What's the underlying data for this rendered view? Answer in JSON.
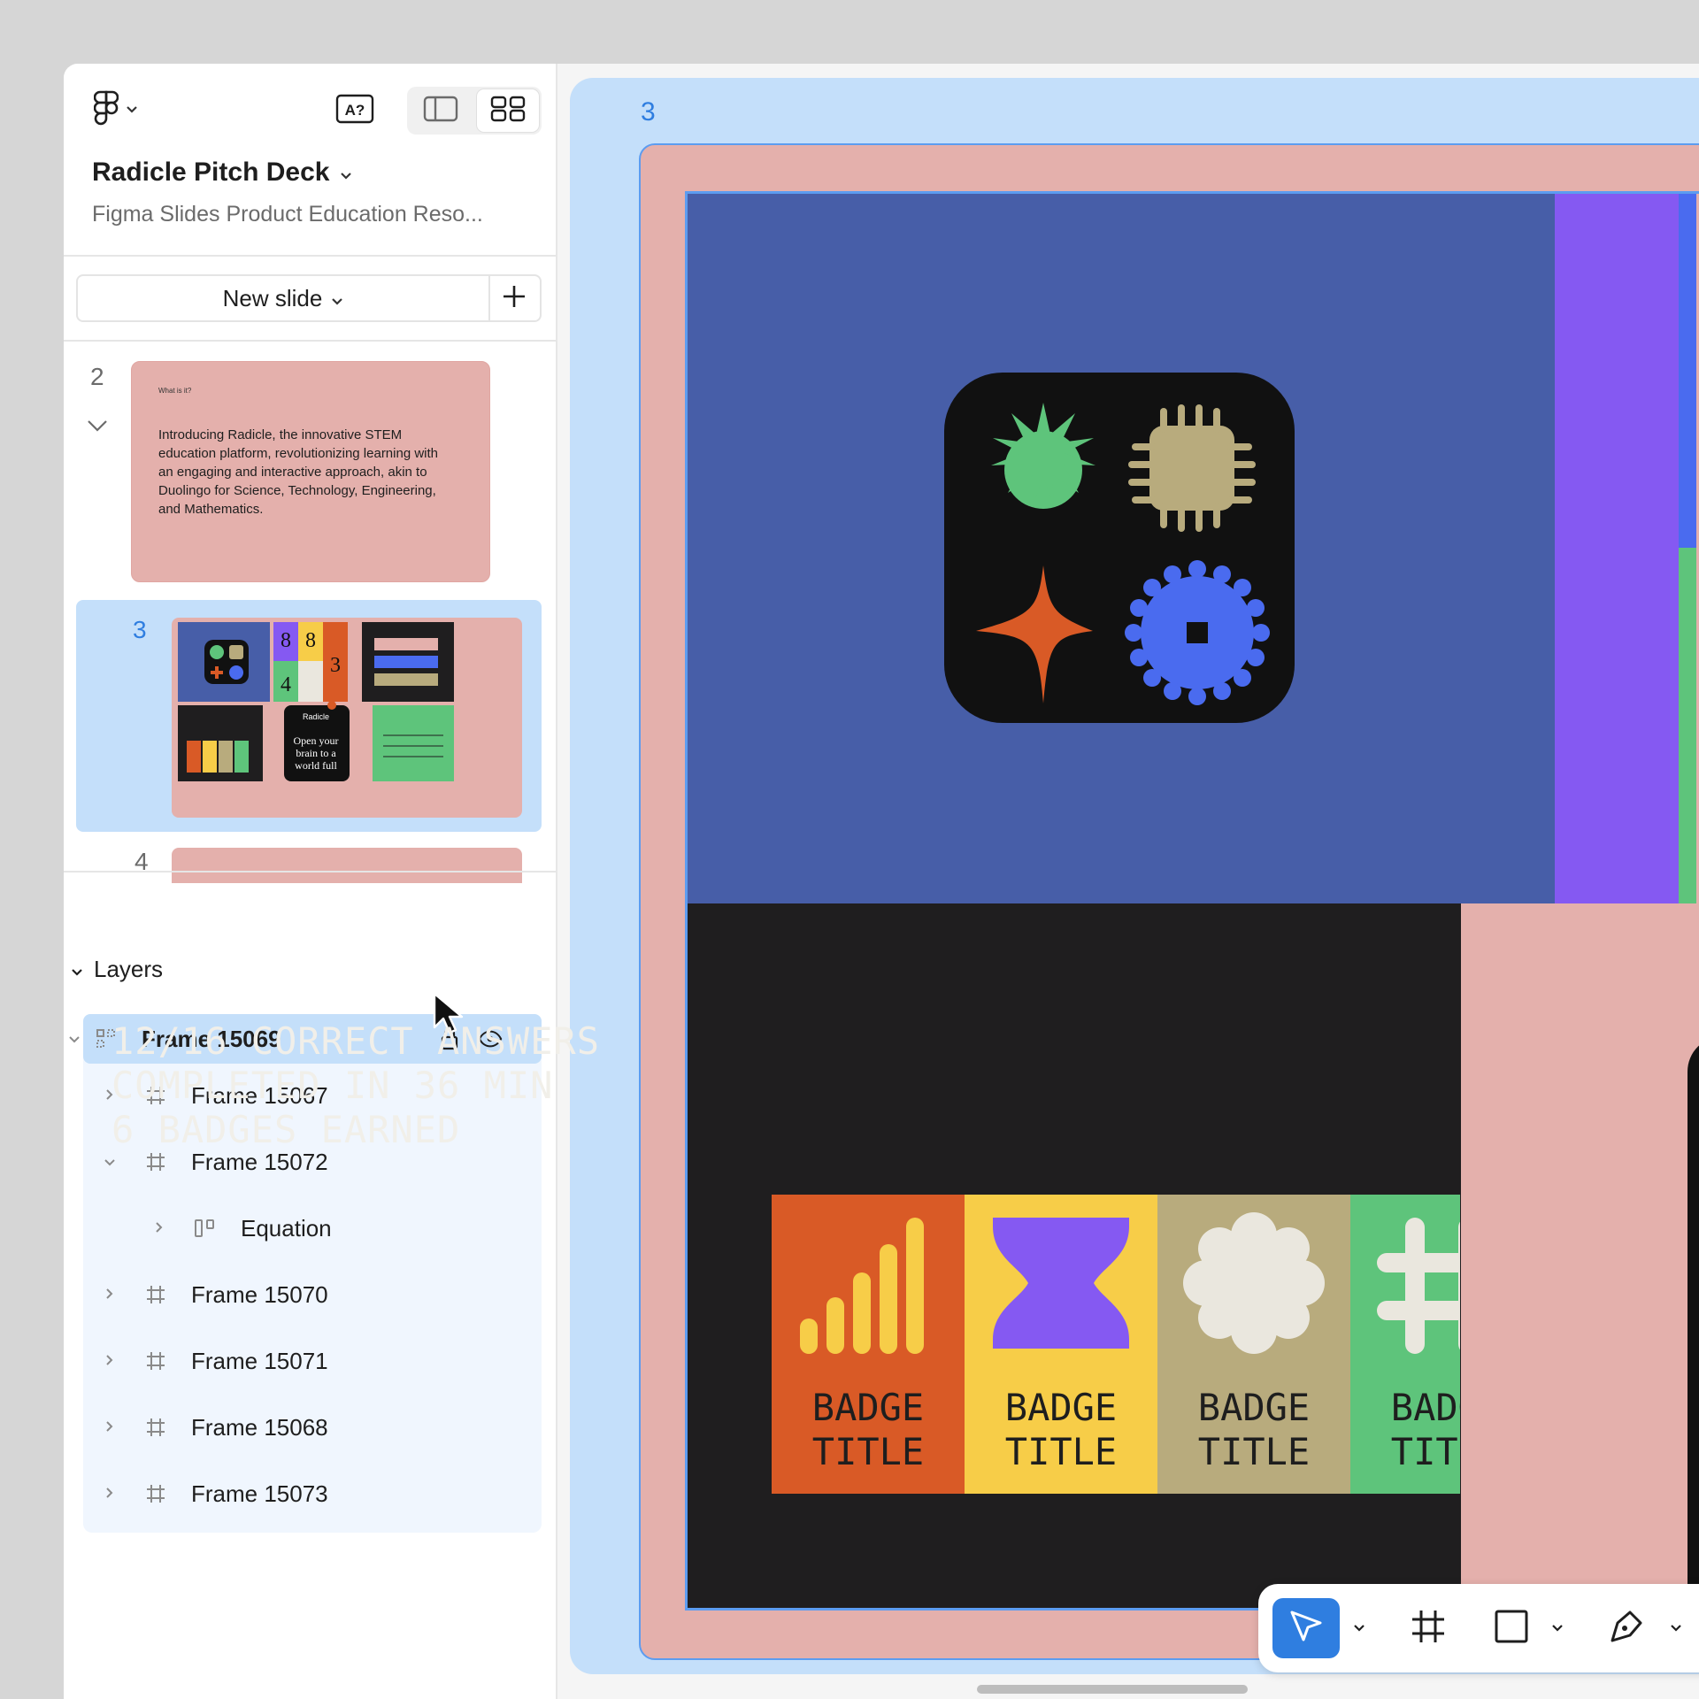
{
  "file": {
    "title": "Radicle Pitch Deck",
    "subtitle": "Figma Slides Product Education Reso..."
  },
  "header": {
    "help_label": "A?"
  },
  "slides_panel": {
    "new_slide_label": "New slide",
    "slides": [
      {
        "number": "2",
        "kicker": "What is it?",
        "text": "Introducing Radicle, the innovative STEM education platform, revolutionizing learning with an engaging and interactive approach, akin to Duolingo for Science, Technology, Engineering, and Mathematics."
      },
      {
        "number": "3",
        "mini_numbers": [
          "8",
          "8",
          "4",
          "3"
        ],
        "mini_brand": "Radicle",
        "mini_quote": "Open your brain to a world full of learning."
      },
      {
        "number": "4"
      }
    ]
  },
  "layers": {
    "heading": "Layers",
    "items": [
      {
        "name": "Frame 15069",
        "icon": "grid-frame-icon",
        "selected": true,
        "expanded": true
      },
      {
        "name": "Frame 15067",
        "icon": "hash-frame-icon"
      },
      {
        "name": "Frame 15072",
        "icon": "hash-frame-icon",
        "expanded": true
      },
      {
        "name": "Equation",
        "icon": "auto-layout-icon"
      },
      {
        "name": "Frame 15070",
        "icon": "hash-frame-icon"
      },
      {
        "name": "Frame 15071",
        "icon": "hash-frame-icon"
      },
      {
        "name": "Frame 15068",
        "icon": "hash-frame-icon"
      },
      {
        "name": "Frame 15073",
        "icon": "hash-frame-icon"
      }
    ]
  },
  "canvas": {
    "slide_number": "3",
    "stats": [
      "12/16 CORRECT ANSWERS",
      "COMPLETED IN 36 MIN",
      "6 BADGES EARNED"
    ],
    "badges": [
      {
        "line1": "BADGE",
        "line2": "TITLE",
        "color": "#d95a26"
      },
      {
        "line1": "BADGE",
        "line2": "TITLE",
        "color": "#f7cd48"
      },
      {
        "line1": "BADGE",
        "line2": "TITLE",
        "color": "#b8ab7d"
      },
      {
        "line1": "BADGE",
        "line2": "TITLE",
        "color": "#5ec47b"
      }
    ]
  },
  "toolbar": {
    "tools": [
      "move-tool",
      "frame-tool",
      "rectangle-tool",
      "pen-tool"
    ],
    "active_tool": "move-tool"
  },
  "colors": {
    "accent": "#2f7ee0",
    "selection": "#c4dffa",
    "slide_pink": "#e4b0ac",
    "slide_blue": "#475ea8",
    "slide_dark": "#1f1e1f"
  }
}
